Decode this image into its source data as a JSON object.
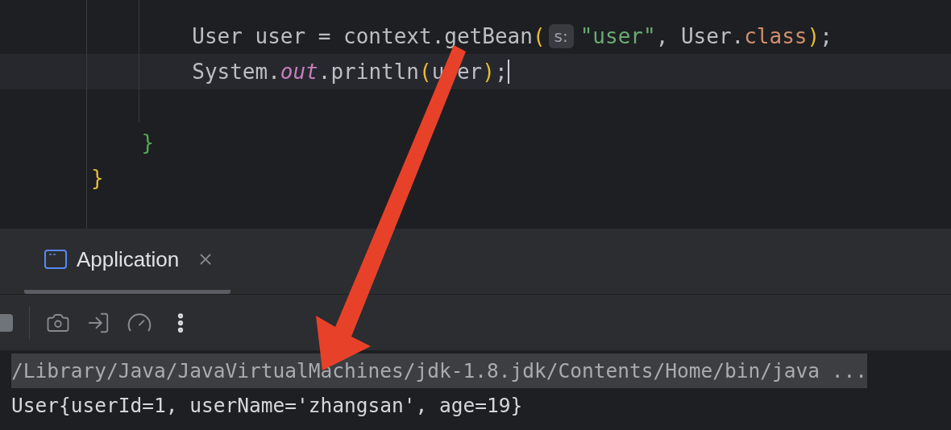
{
  "editor": {
    "lines": [
      {
        "current": false,
        "tokens": [
          {
            "kind": "plain",
            "text": "        User user = context.getBean"
          },
          {
            "kind": "bracket",
            "text": "(",
            "color": "#e8ba36"
          },
          {
            "kind": "hint",
            "text": "s:"
          },
          {
            "kind": "string",
            "text": "\"user\""
          },
          {
            "kind": "plain",
            "text": ", User."
          },
          {
            "kind": "keyword",
            "text": "class"
          },
          {
            "kind": "bracket",
            "text": ")",
            "color": "#e8ba36"
          },
          {
            "kind": "plain",
            "text": ";"
          }
        ]
      },
      {
        "current": true,
        "tokens": [
          {
            "kind": "plain",
            "text": "        System."
          },
          {
            "kind": "field",
            "text": "out"
          },
          {
            "kind": "plain",
            "text": ".println"
          },
          {
            "kind": "bracket",
            "text": "(",
            "color": "#e8ba36"
          },
          {
            "kind": "plain",
            "text": "u"
          },
          {
            "kind": "covered"
          },
          {
            "kind": "plain",
            "text": "er"
          },
          {
            "kind": "bracket",
            "text": ")",
            "color": "#e8ba36"
          },
          {
            "kind": "plain",
            "text": ";"
          }
        ]
      },
      {
        "current": false
      },
      {
        "current": false,
        "tokens": [
          {
            "kind": "bracket",
            "text": "    }",
            "color": "#54a857"
          }
        ]
      },
      {
        "current": false,
        "tokens": [
          {
            "kind": "bracket",
            "text": "}",
            "color": "#e8ba36"
          }
        ]
      }
    ]
  },
  "tool_window": {
    "tabs": [
      {
        "label": "Application",
        "selected": true
      }
    ]
  },
  "console": {
    "lines": [
      {
        "kind": "command",
        "text": "/Library/Java/JavaVirtualMachines/jdk-1.8.jdk/Contents/Home/bin/java ..."
      },
      {
        "kind": "output",
        "text": "User{userId=1, userName='zhangsan', age=19}"
      }
    ]
  }
}
